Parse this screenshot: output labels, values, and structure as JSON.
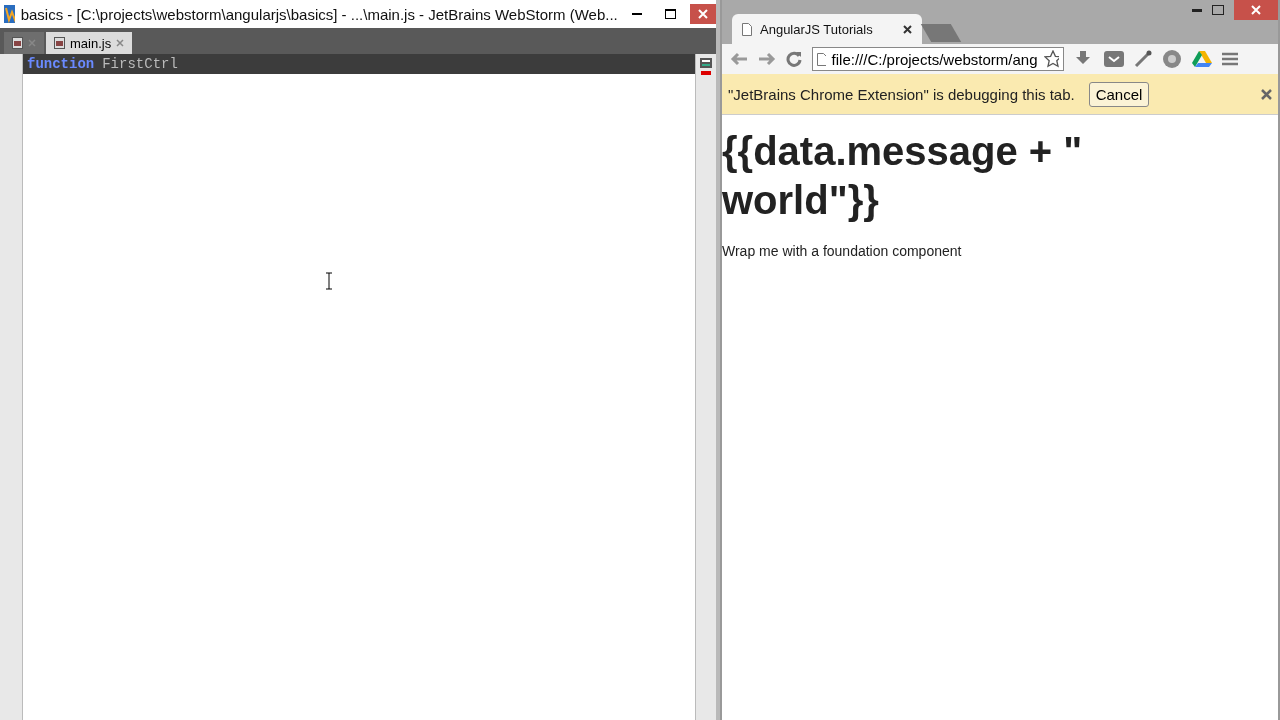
{
  "ide": {
    "title": "basics - [C:\\projects\\webstorm\\angularjs\\basics] - ...\\main.js - JetBrains WebStorm (Web...",
    "tabs": [
      {
        "selected": false
      },
      {
        "label": "main.js",
        "selected": true
      }
    ],
    "code": [
      {
        "keyword": "function",
        "name": "FirstCtrl"
      }
    ]
  },
  "browser": {
    "tabs": [
      {
        "label": "AngularJS Tutorials",
        "selected": true
      }
    ],
    "address": "file:///C:/projects/webstorm/ang",
    "infobar": {
      "message": "\"JetBrains Chrome Extension\" is debugging this tab.",
      "button": "Cancel"
    },
    "heading": "{{data.message + \" world\"}}",
    "paragraph": "Wrap me with a foundation component"
  }
}
